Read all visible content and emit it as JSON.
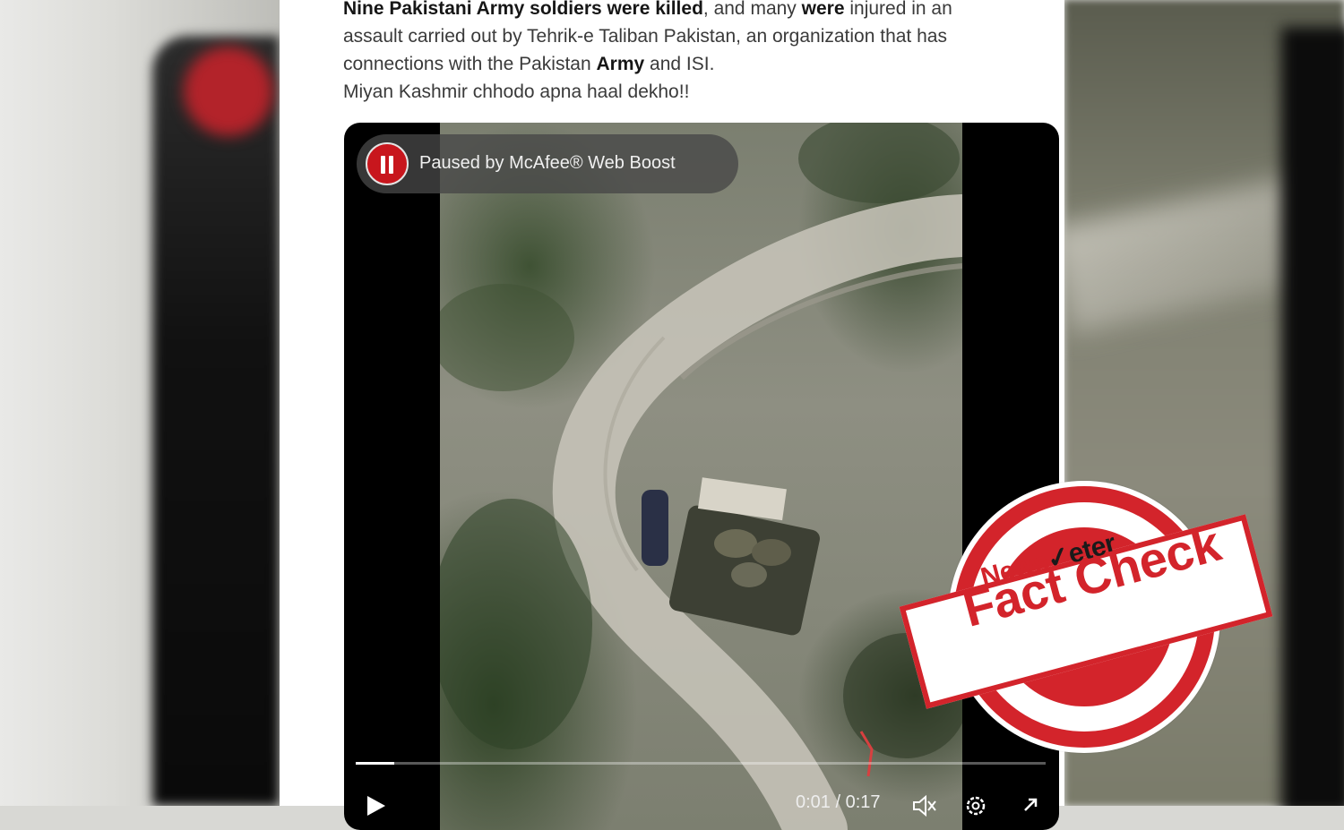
{
  "tweet": {
    "line1_bold": "Nine Pakistani Army soldiers were killed",
    "line1_mid": ", and many ",
    "line1_bold2": "were",
    "line1_end": " injured in an",
    "line2": "assault carried out by Tehrik-e Taliban Pakistan, an organization that has",
    "line3_start": "connections with the Pakistan ",
    "line3_bold": "Army",
    "line3_end": " and ISI.",
    "line4": "Miyan Kashmir chhodo apna haal dekho!!"
  },
  "video": {
    "paused_label": "Paused by McAfee® Web Boost",
    "time_label": "0:01 / 0:17",
    "progress_fraction": 0.056
  },
  "stamp": {
    "brand_part1": "News",
    "brand_part2": "eter",
    "title": "Fact Check"
  },
  "icons": {
    "pause": "pause-icon",
    "play": "play-icon",
    "mute": "mute-icon",
    "settings": "gear-icon",
    "fullscreen": "expand-icon"
  },
  "colors": {
    "stamp_red": "#d3242b",
    "mcafee_red": "#c8161d"
  }
}
